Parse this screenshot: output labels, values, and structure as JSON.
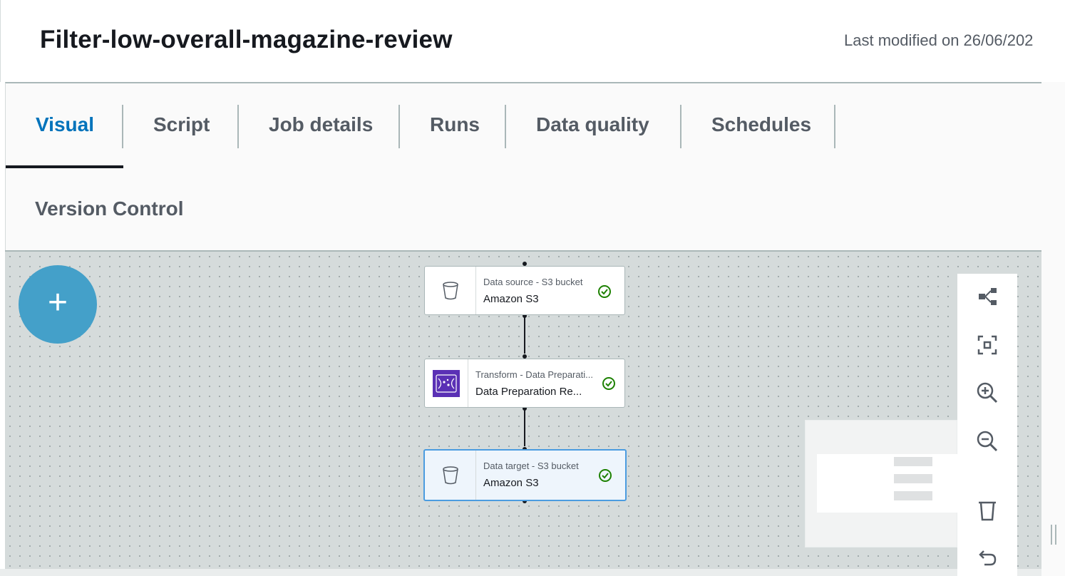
{
  "header": {
    "title": "Filter-low-overall-magazine-review",
    "last_modified": "Last modified on 26/06/202"
  },
  "tabs": [
    {
      "label": "Visual",
      "active": true
    },
    {
      "label": "Script",
      "active": false
    },
    {
      "label": "Job details",
      "active": false
    },
    {
      "label": "Runs",
      "active": false
    },
    {
      "label": "Data quality",
      "active": false
    },
    {
      "label": "Schedules",
      "active": false
    }
  ],
  "version_control": "Version Control",
  "canvas": {
    "add_button": "+",
    "nodes": [
      {
        "type": "Data source - S3 bucket",
        "name": "Amazon S3",
        "icon": "s3-bucket-icon",
        "status": "success",
        "selected": false
      },
      {
        "type": "Transform - Data Preparati...",
        "name": "Data Preparation Re...",
        "icon": "databrew-icon",
        "status": "success",
        "selected": false
      },
      {
        "type": "Data target - S3 bucket",
        "name": "Amazon S3",
        "icon": "s3-bucket-icon",
        "status": "success",
        "selected": true
      }
    ]
  },
  "toolbar": {
    "tools": [
      "layout-icon",
      "fit-view-icon",
      "zoom-in-icon",
      "zoom-out-icon",
      "delete-icon",
      "undo-icon"
    ]
  },
  "colors": {
    "accent": "#0073bb",
    "add_button": "#44a0c9",
    "success": "#1d8102",
    "transform_icon": "#5a30b5",
    "canvas": "#d5dbdb"
  }
}
